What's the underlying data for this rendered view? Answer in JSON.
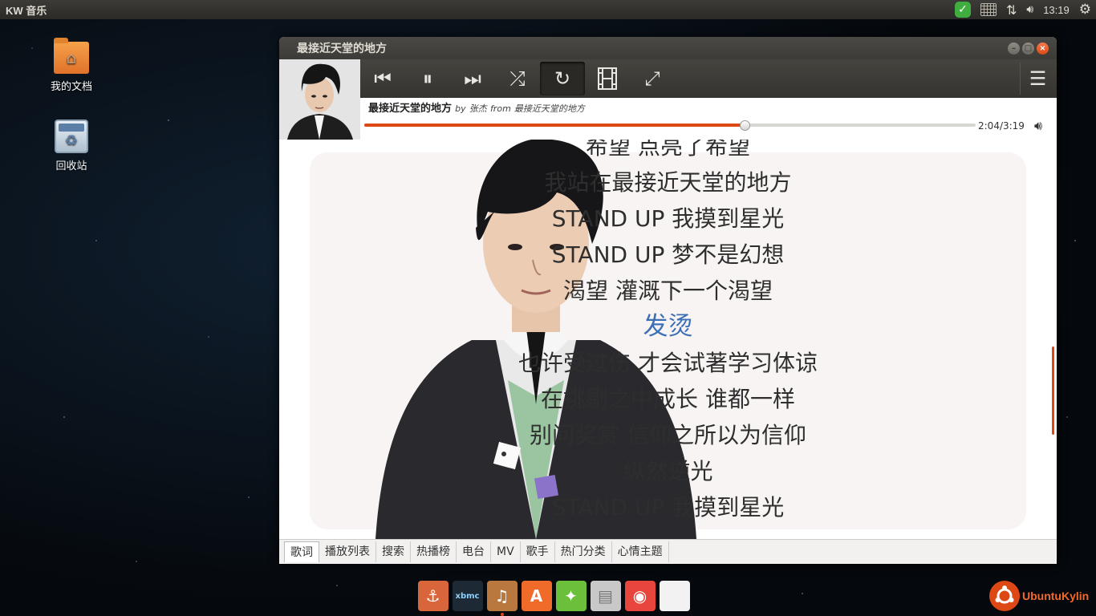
{
  "top_panel": {
    "app_name": "KW 音乐",
    "clock": "13:19"
  },
  "desktop": {
    "icons": [
      {
        "label": "我的文档"
      },
      {
        "label": "回收站"
      }
    ]
  },
  "window": {
    "title": "最接近天堂的地方",
    "player": {
      "song_title": "最接近天堂的地方",
      "by_word": "by",
      "artist": "张杰",
      "from_word": "from",
      "album": "最接近天堂的地方",
      "elapsed": "2:04",
      "duration": "3:19",
      "time_text": "2:04/3:19",
      "progress_fraction": 0.622,
      "repeat_active": true
    },
    "lyrics": {
      "lines": [
        "希望 点亮了希望",
        "我站在最接近天堂的地方",
        "STAND UP 我摸到星光",
        "STAND UP 梦不是幻想",
        "渴望 灌溉下一个渴望",
        "发烫",
        "也许受过伤 才会试著学习体谅",
        "在挑剔之中成长 谁都一样",
        "别问奖赏 信仰之所以为信仰",
        "纵然逆光",
        "STAND UP 我摸到星光"
      ],
      "current_index": 5
    },
    "tabs": [
      {
        "label": "歌词",
        "selected": true
      },
      {
        "label": "播放列表"
      },
      {
        "label": "搜索"
      },
      {
        "label": "热播榜"
      },
      {
        "label": "电台"
      },
      {
        "label": "MV"
      },
      {
        "label": "歌手"
      },
      {
        "label": "热门分类"
      },
      {
        "label": "心情主题"
      }
    ]
  },
  "dock": {
    "items": [
      {
        "icon": "anchor-icon",
        "color": "#d9663a"
      },
      {
        "icon": "xbmc-icon",
        "color": "#1d2a36",
        "text": "xbmc"
      },
      {
        "icon": "music-box-icon",
        "color": "#b9793e"
      },
      {
        "icon": "software-center-icon",
        "color": "#f06b2a"
      },
      {
        "icon": "puzzle-icon",
        "color": "#6bbf3a"
      },
      {
        "icon": "file-cabinet-icon",
        "color": "#c8c8c8"
      },
      {
        "icon": "chrome-icon",
        "color": "#e8453c"
      },
      {
        "icon": "document-icon",
        "color": "#f2f2f2"
      }
    ]
  },
  "brand": {
    "label": "UbuntuKylin",
    "color": "#dd4814"
  }
}
